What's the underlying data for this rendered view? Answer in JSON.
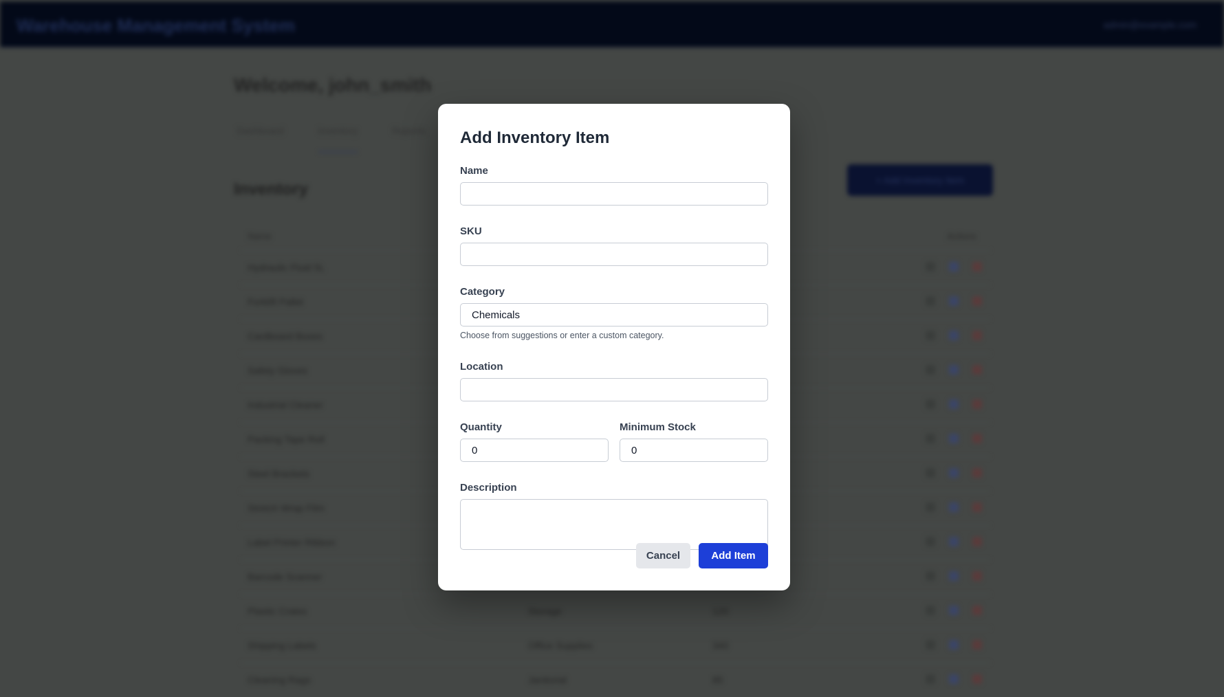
{
  "background": {
    "app_title": "Warehouse Management System",
    "user_label": "admin@example.com",
    "page_title": "Welcome, john_smith",
    "tabs": [
      "Dashboard",
      "Inventory",
      "Reports"
    ],
    "section_title": "Inventory",
    "add_button_label": "+ Add Inventory Item",
    "table_headers": {
      "name": "Name",
      "actions": "Actions"
    },
    "rows": [
      {
        "name": "Hydraulic Fluid 5L"
      },
      {
        "name": "Forklift Pallet"
      },
      {
        "name": "Cardboard Boxes"
      },
      {
        "name": "Safety Gloves"
      },
      {
        "name": "Industrial Cleaner"
      },
      {
        "name": "Packing Tape Roll"
      },
      {
        "name": "Steel Brackets"
      },
      {
        "name": "Stretch Wrap Film"
      },
      {
        "name": "Label Printer Ribbon"
      },
      {
        "name": "Barcode Scanner"
      },
      {
        "name": "Plastic Crates",
        "category": "Storage",
        "quantity": "120"
      },
      {
        "name": "Shipping Labels",
        "category": "Office Supplies",
        "quantity": "340"
      },
      {
        "name": "Cleaning Rags",
        "category": "Janitorial",
        "quantity": "85"
      }
    ]
  },
  "modal": {
    "title": "Add Inventory Item",
    "name": {
      "label": "Name",
      "value": ""
    },
    "sku": {
      "label": "SKU",
      "value": ""
    },
    "category": {
      "label": "Category",
      "value": "Chemicals",
      "hint": "Choose from suggestions or enter a custom category."
    },
    "location": {
      "label": "Location",
      "value": ""
    },
    "quantity": {
      "label": "Quantity",
      "value": "0"
    },
    "min_stock": {
      "label": "Minimum Stock",
      "value": "0"
    },
    "description": {
      "label": "Description",
      "value": ""
    },
    "cancel_label": "Cancel",
    "submit_label": "Add Item"
  },
  "colors": {
    "overlay": "#444745",
    "primary": "#1d3fd8",
    "cancel_bg": "#e5e7eb",
    "topbar": "#030918"
  }
}
